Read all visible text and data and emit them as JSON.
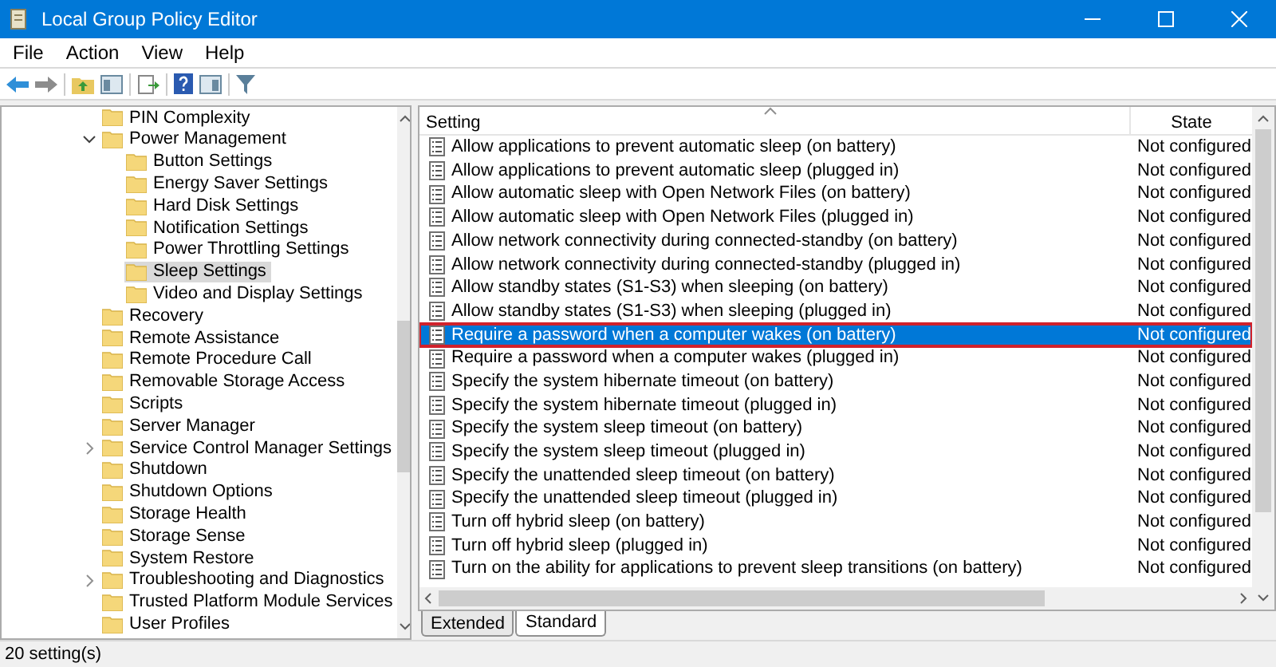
{
  "window": {
    "title": "Local Group Policy Editor"
  },
  "menu": [
    "File",
    "Action",
    "View",
    "Help"
  ],
  "tree": [
    {
      "label": "PIN Complexity",
      "selected": false
    },
    {
      "label": "Power Management",
      "selected": false,
      "expanded": true,
      "children": [
        {
          "label": "Button Settings",
          "selected": false
        },
        {
          "label": "Energy Saver Settings",
          "selected": false
        },
        {
          "label": "Hard Disk Settings",
          "selected": false
        },
        {
          "label": "Notification Settings",
          "selected": false
        },
        {
          "label": "Power Throttling Settings",
          "selected": false
        },
        {
          "label": "Sleep Settings",
          "selected": true
        },
        {
          "label": "Video and Display Settings",
          "selected": false
        }
      ]
    },
    {
      "label": "Recovery",
      "selected": false
    },
    {
      "label": "Remote Assistance",
      "selected": false
    },
    {
      "label": "Remote Procedure Call",
      "selected": false
    },
    {
      "label": "Removable Storage Access",
      "selected": false
    },
    {
      "label": "Scripts",
      "selected": false
    },
    {
      "label": "Server Manager",
      "selected": false
    },
    {
      "label": "Service Control Manager Settings",
      "selected": false,
      "expanded": false
    },
    {
      "label": "Shutdown",
      "selected": false
    },
    {
      "label": "Shutdown Options",
      "selected": false
    },
    {
      "label": "Storage Health",
      "selected": false
    },
    {
      "label": "Storage Sense",
      "selected": false
    },
    {
      "label": "System Restore",
      "selected": false
    },
    {
      "label": "Troubleshooting and Diagnostics",
      "selected": false,
      "expanded": false
    },
    {
      "label": "Trusted Platform Module Services",
      "selected": false
    },
    {
      "label": "User Profiles",
      "selected": false
    }
  ],
  "table": {
    "columns": [
      "Setting",
      "State"
    ],
    "rows": [
      {
        "setting": "Allow applications to prevent automatic sleep (on battery)",
        "state": "Not configured",
        "selected": false
      },
      {
        "setting": "Allow applications to prevent automatic sleep (plugged in)",
        "state": "Not configured",
        "selected": false
      },
      {
        "setting": "Allow automatic sleep with Open Network Files (on battery)",
        "state": "Not configured",
        "selected": false
      },
      {
        "setting": "Allow automatic sleep with Open Network Files (plugged in)",
        "state": "Not configured",
        "selected": false
      },
      {
        "setting": "Allow network connectivity during connected-standby (on battery)",
        "state": "Not configured",
        "selected": false
      },
      {
        "setting": "Allow network connectivity during connected-standby (plugged in)",
        "state": "Not configured",
        "selected": false
      },
      {
        "setting": "Allow standby states (S1-S3) when sleeping (on battery)",
        "state": "Not configured",
        "selected": false
      },
      {
        "setting": "Allow standby states (S1-S3) when sleeping (plugged in)",
        "state": "Not configured",
        "selected": false
      },
      {
        "setting": "Require a password when a computer wakes (on battery)",
        "state": "Not configured",
        "selected": true,
        "highlighted": true
      },
      {
        "setting": "Require a password when a computer wakes (plugged in)",
        "state": "Not configured",
        "selected": false
      },
      {
        "setting": "Specify the system hibernate timeout (on battery)",
        "state": "Not configured",
        "selected": false
      },
      {
        "setting": "Specify the system hibernate timeout (plugged in)",
        "state": "Not configured",
        "selected": false
      },
      {
        "setting": "Specify the system sleep timeout (on battery)",
        "state": "Not configured",
        "selected": false
      },
      {
        "setting": "Specify the system sleep timeout (plugged in)",
        "state": "Not configured",
        "selected": false
      },
      {
        "setting": "Specify the unattended sleep timeout (on battery)",
        "state": "Not configured",
        "selected": false
      },
      {
        "setting": "Specify the unattended sleep timeout (plugged in)",
        "state": "Not configured",
        "selected": false
      },
      {
        "setting": "Turn off hybrid sleep (on battery)",
        "state": "Not configured",
        "selected": false
      },
      {
        "setting": "Turn off hybrid sleep (plugged in)",
        "state": "Not configured",
        "selected": false
      },
      {
        "setting": "Turn on the ability for applications to prevent sleep transitions (on battery)",
        "state": "Not configured",
        "selected": false
      }
    ]
  },
  "view_tabs": [
    {
      "label": "Extended",
      "selected": false
    },
    {
      "label": "Standard",
      "selected": true
    }
  ],
  "status_bar": "20 setting(s)"
}
